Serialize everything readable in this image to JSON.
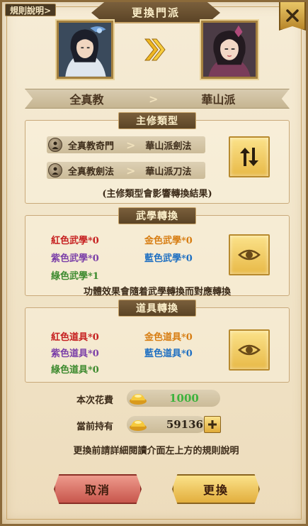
{
  "header": {
    "rules_link": "規則說明>",
    "title": "更換門派"
  },
  "transfer": {
    "from_sect": "全真教",
    "to_sect": "華山派",
    "separator": ">"
  },
  "main_skill": {
    "title": "主修類型",
    "rows": [
      {
        "from": "全真教奇門",
        "to": "華山派劍法"
      },
      {
        "from": "全真教劍法",
        "to": "華山派刀法"
      }
    ],
    "note": "(主修類型會影響轉換結果)"
  },
  "martial_conversion": {
    "title": "武學轉換",
    "red": "紅色武學*0",
    "gold": "金色武學*0",
    "purple": "紫色武學*0",
    "blue": "藍色武學*0",
    "green": "綠色武學*1",
    "note": "功體效果會隨着武學轉換而對應轉換"
  },
  "item_conversion": {
    "title": "道具轉換",
    "red": "紅色道具*0",
    "gold": "金色道具*0",
    "purple": "紫色道具*0",
    "blue": "藍色道具*0",
    "green": "綠色道具*0"
  },
  "cost": {
    "label": "本次花費",
    "value": "1000",
    "value_color": "#3db33d"
  },
  "holding": {
    "label": "當前持有",
    "value": "59136"
  },
  "warning": "更換前請詳細閱讀介面左上方的規則說明",
  "buttons": {
    "cancel": "取消",
    "confirm": "更換"
  },
  "colors": {
    "red": "#c62020",
    "gold": "#d77d12",
    "purple": "#7b3fa8",
    "blue": "#1e6fc2",
    "green": "#3c8a2e"
  }
}
